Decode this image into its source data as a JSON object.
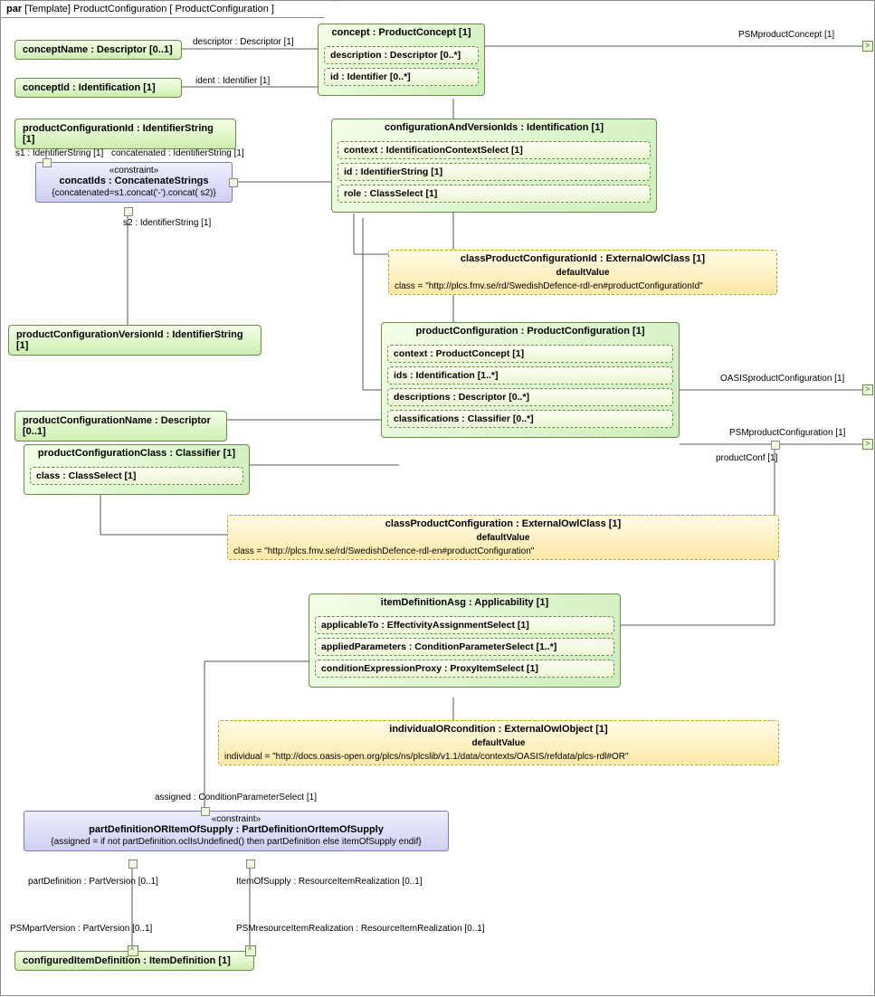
{
  "frame": {
    "kw": "par",
    "kind": "[Template]",
    "name": "ProductConfiguration",
    "param": "[ ProductConfiguration ]"
  },
  "conceptName": "conceptName : Descriptor [0..1]",
  "conceptId": "conceptId : Identification [1]",
  "productConfigurationId": "productConfigurationId : IdentifierString [1]",
  "productConfigurationVersionId": "productConfigurationVersionId : IdentifierString [1]",
  "productConfigurationName": "productConfigurationName : Descriptor [0..1]",
  "productConfigurationClass": {
    "title": "productConfigurationClass : Classifier [1]",
    "class": "class : ClassSelect [1]"
  },
  "configuredItemDefinition": "configuredItemDefinition : ItemDefinition [1]",
  "conceptBlock": {
    "title": "concept : ProductConcept [1]",
    "description": "description : Descriptor [0..*]",
    "id": "id : Identifier [0..*]"
  },
  "configAndVersionIds": {
    "title": "configurationAndVersionIds : Identification [1]",
    "context": "context : IdentificationContextSelect [1]",
    "id": "id : IdentifierString [1]",
    "role": "role : ClassSelect [1]"
  },
  "productConfiguration": {
    "title": "productConfiguration : ProductConfiguration [1]",
    "context": "context : ProductConcept [1]",
    "ids": "ids : Identification [1..*]",
    "descriptions": "descriptions : Descriptor [0..*]",
    "classifications": "classifications : Classifier [0..*]"
  },
  "itemDefinitionAsg": {
    "title": "itemDefinitionAsg : Applicability [1]",
    "applicableTo": "applicableTo : EffectivityAssignmentSelect [1]",
    "appliedParameters": "appliedParameters : ConditionParameterSelect [1..*]",
    "conditionExpressionProxy": "conditionExpressionProxy : ProxyItemSelect [1]"
  },
  "classProductConfigurationId": {
    "title": "classProductConfigurationId : ExternalOwlClass [1]",
    "sub": "defaultValue",
    "body": "class = \"http://plcs.fmv.se/rd/SwedishDefence-rdl-en#productConfigurationId\""
  },
  "classProductConfiguration": {
    "title": "classProductConfiguration : ExternalOwlClass [1]",
    "sub": "defaultValue",
    "body": "class = \"http://plcs.fmv.se/rd/SwedishDefence-rdl-en#productConfiguration\""
  },
  "individualORcondition": {
    "title": "individualORcondition : ExternalOwlObject [1]",
    "sub": "defaultValue",
    "body": "individual = \"http://docs.oasis-open.org/plcs/ns/plcslib/v1.1/data/contexts/OASIS/refdata/plcs-rdl#OR\""
  },
  "concatIds": {
    "st": "«constraint»",
    "nm": "concatIds : ConcatenateStrings",
    "ex": "{concatenated=s1.concat('-').concat( s2)}"
  },
  "partDefConstraint": {
    "st": "«constraint»",
    "nm": "partDefinitionORItemOfSupply : PartDefinitionOrItemOfSupply",
    "ex": "{assigned = if not partDefinition.oclIsUndefined() then  partDefinition else itemOfSupply endif}"
  },
  "edgeLabels": {
    "descriptor": "descriptor : Descriptor [1]",
    "ident": "ident : Identifier [1]",
    "s1": "s1 : IdentifierString [1]",
    "concatenated": "concatenated : IdentifierString [1]",
    "s2": "s2 : IdentifierString [1]",
    "psmProductConcept": "PSMproductConcept [1]",
    "oasisProductConfiguration": "OASISproductConfiguration [1]",
    "psmProductConfiguration": "PSMproductConfiguration [1]",
    "productConf": "productConf [1]",
    "assigned": "assigned : ConditionParameterSelect [1]",
    "partDefinition": "partDefinition : PartVersion [0..1]",
    "itemOfSupply": "ItemOfSupply : ResourceItemRealization [0..1]",
    "psmPartVersion": "PSMpartVersion : PartVersion [0..1]",
    "psmResourceItemRealization": "PSMresourceItemRealization : ResourceItemRealization [0..1]"
  }
}
